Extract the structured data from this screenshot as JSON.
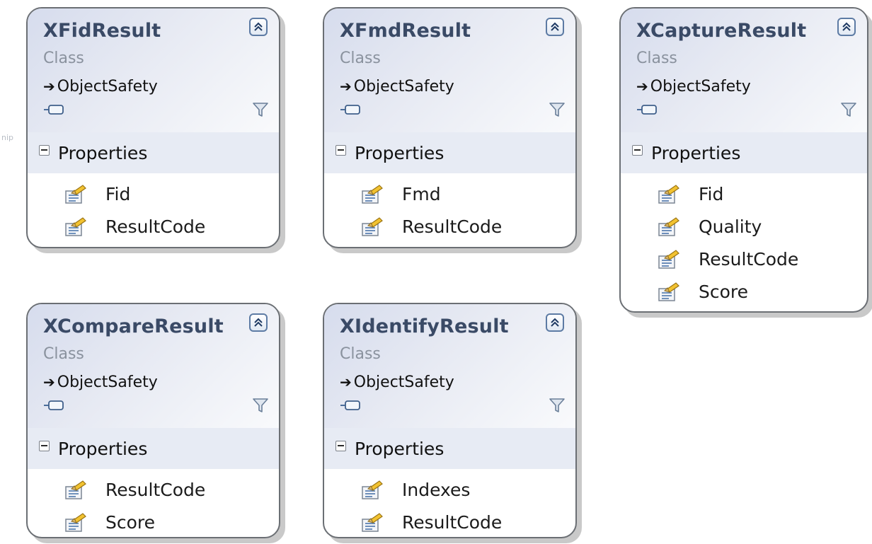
{
  "edge_fragment": "nip",
  "shapes": [
    {
      "name": "XFidResult",
      "kind": "Class",
      "base": "ObjectSafety",
      "section": "Properties",
      "members": [
        "Fid",
        "ResultCode"
      ]
    },
    {
      "name": "XFmdResult",
      "kind": "Class",
      "base": "ObjectSafety",
      "section": "Properties",
      "members": [
        "Fmd",
        "ResultCode"
      ]
    },
    {
      "name": "XCaptureResult",
      "kind": "Class",
      "base": "ObjectSafety",
      "section": "Properties",
      "members": [
        "Fid",
        "Quality",
        "ResultCode",
        "Score"
      ]
    },
    {
      "name": "XCompareResult",
      "kind": "Class",
      "base": "ObjectSafety",
      "section": "Properties",
      "members": [
        "ResultCode",
        "Score"
      ]
    },
    {
      "name": "XIdentifyResult",
      "kind": "Class",
      "base": "ObjectSafety",
      "section": "Properties",
      "members": [
        "Indexes",
        "ResultCode"
      ]
    }
  ],
  "icons": {
    "collapse": "double-chevron-up-icon",
    "interface": "interface-lollipop-icon",
    "filter": "funnel-icon",
    "inheritance": "inheritance-arrow-icon",
    "section_toggle": "minus-box-icon",
    "property": "property-icon"
  },
  "colors": {
    "header_gradient_start": "#d6dced",
    "header_gradient_end": "#f9fafc",
    "section_band": "#e7ebf4",
    "title_text": "#3a4a66",
    "kind_text": "#8a929e",
    "border": "#6b6f74",
    "shadow": "#c9c9c9"
  }
}
